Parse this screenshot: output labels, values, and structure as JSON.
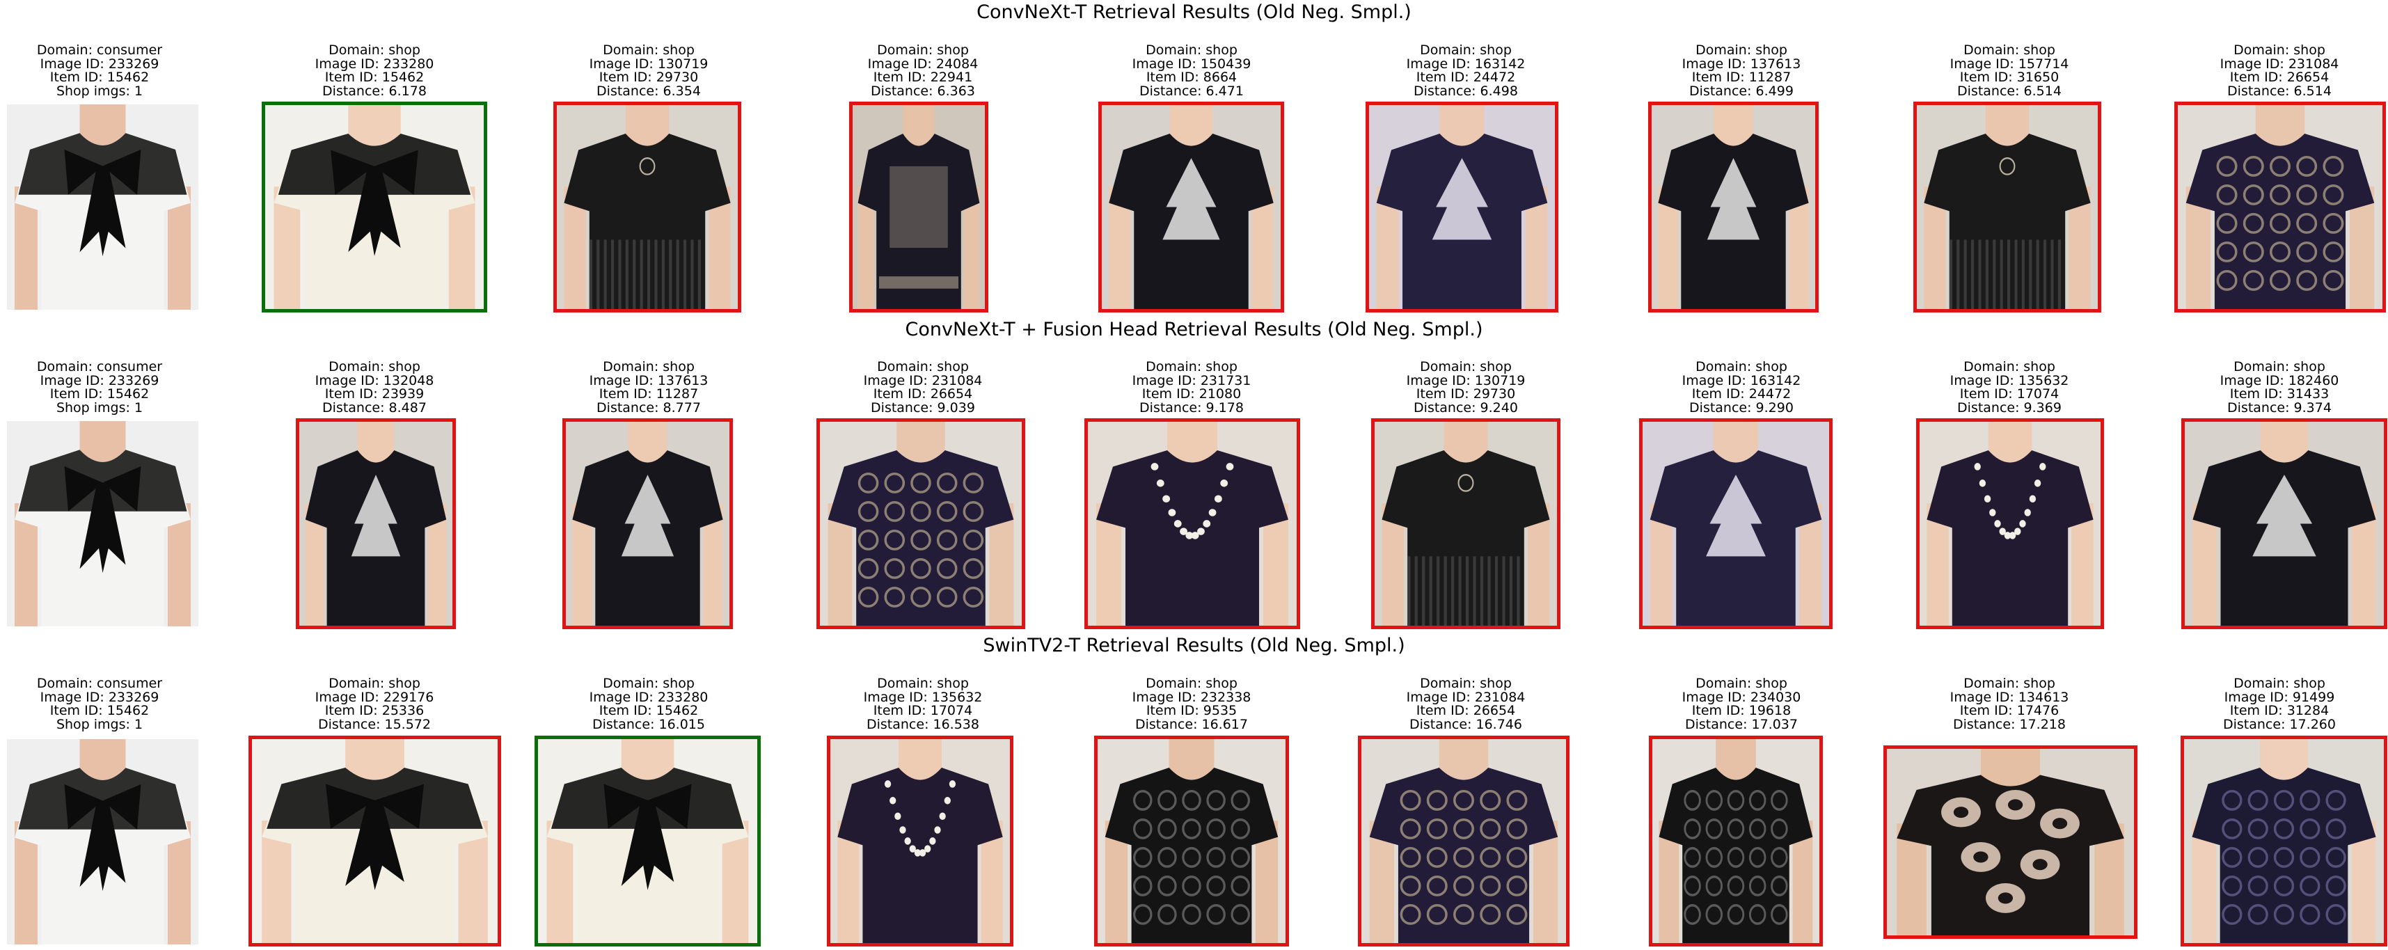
{
  "colors": {
    "match_border": "#0a6e0a",
    "nonmatch_border": "#e01414"
  },
  "rows": [
    {
      "title": "ConvNeXt-T Retrieval Results (Old Neg. Smpl.)",
      "items": [
        {
          "lines": [
            "Domain: consumer",
            "Image ID: 233269",
            "Item ID: 15462",
            "Shop imgs: 1"
          ],
          "border": "none",
          "scene": "query"
        },
        {
          "lines": [
            "Domain: shop",
            "Image ID: 233280",
            "Item ID: 15462",
            "Distance: 6.178"
          ],
          "border": "green",
          "scene": "white-top"
        },
        {
          "lines": [
            "Domain: shop",
            "Image ID: 130719",
            "Item ID: 29730",
            "Distance: 6.354"
          ],
          "border": "red",
          "scene": "black-fringe"
        },
        {
          "lines": [
            "Domain: shop",
            "Image ID: 24084",
            "Item ID: 22941",
            "Distance: 6.363"
          ],
          "border": "red",
          "scene": "dark-dress"
        },
        {
          "lines": [
            "Domain: shop",
            "Image ID: 150439",
            "Item ID: 8664",
            "Distance: 6.471"
          ],
          "border": "red",
          "scene": "black-print"
        },
        {
          "lines": [
            "Domain: shop",
            "Image ID: 163142",
            "Item ID: 24472",
            "Distance: 6.498"
          ],
          "border": "red",
          "scene": "navy-print"
        },
        {
          "lines": [
            "Domain: shop",
            "Image ID: 137613",
            "Item ID: 11287",
            "Distance: 6.499"
          ],
          "border": "red",
          "scene": "black-print"
        },
        {
          "lines": [
            "Domain: shop",
            "Image ID: 157714",
            "Item ID: 31650",
            "Distance: 6.514"
          ],
          "border": "red",
          "scene": "black-fringe"
        },
        {
          "lines": [
            "Domain: shop",
            "Image ID: 231084",
            "Item ID: 26654",
            "Distance: 6.514"
          ],
          "border": "red",
          "scene": "navy-lace"
        }
      ]
    },
    {
      "title": "ConvNeXt-T + Fusion Head Retrieval Results (Old Neg. Smpl.)",
      "items": [
        {
          "lines": [
            "Domain: consumer",
            "Image ID: 233269",
            "Item ID: 15462",
            "Shop imgs: 1"
          ],
          "border": "none",
          "scene": "query"
        },
        {
          "lines": [
            "Domain: shop",
            "Image ID: 132048",
            "Item ID: 23939",
            "Distance: 8.487"
          ],
          "border": "red",
          "scene": "black-print"
        },
        {
          "lines": [
            "Domain: shop",
            "Image ID: 137613",
            "Item ID: 11287",
            "Distance: 8.777"
          ],
          "border": "red",
          "scene": "black-print"
        },
        {
          "lines": [
            "Domain: shop",
            "Image ID: 231084",
            "Item ID: 26654",
            "Distance: 9.039"
          ],
          "border": "red",
          "scene": "navy-lace"
        },
        {
          "lines": [
            "Domain: shop",
            "Image ID: 231731",
            "Item ID: 21080",
            "Distance: 9.178"
          ],
          "border": "red",
          "scene": "navy-pearl"
        },
        {
          "lines": [
            "Domain: shop",
            "Image ID: 130719",
            "Item ID: 29730",
            "Distance: 9.240"
          ],
          "border": "red",
          "scene": "black-fringe"
        },
        {
          "lines": [
            "Domain: shop",
            "Image ID: 163142",
            "Item ID: 24472",
            "Distance: 9.290"
          ],
          "border": "red",
          "scene": "navy-print"
        },
        {
          "lines": [
            "Domain: shop",
            "Image ID: 135632",
            "Item ID: 17074",
            "Distance: 9.369"
          ],
          "border": "red",
          "scene": "navy-pearl"
        },
        {
          "lines": [
            "Domain: shop",
            "Image ID: 182460",
            "Item ID: 31433",
            "Distance: 9.374"
          ],
          "border": "red",
          "scene": "black-print"
        }
      ]
    },
    {
      "title": "SwinTV2-T Retrieval Results (Old Neg. Smpl.)",
      "items": [
        {
          "lines": [
            "Domain: consumer",
            "Image ID: 233269",
            "Item ID: 15462",
            "Shop imgs: 1"
          ],
          "border": "none",
          "scene": "query"
        },
        {
          "lines": [
            "Domain: shop",
            "Image ID: 229176",
            "Item ID: 25336",
            "Distance: 15.572"
          ],
          "border": "red",
          "scene": "white-top"
        },
        {
          "lines": [
            "Domain: shop",
            "Image ID: 233280",
            "Item ID: 15462",
            "Distance: 16.015"
          ],
          "border": "green",
          "scene": "white-top"
        },
        {
          "lines": [
            "Domain: shop",
            "Image ID: 135632",
            "Item ID: 17074",
            "Distance: 16.538"
          ],
          "border": "red",
          "scene": "navy-pearl"
        },
        {
          "lines": [
            "Domain: shop",
            "Image ID: 232338",
            "Item ID: 9535",
            "Distance: 16.617"
          ],
          "border": "red",
          "scene": "black-lace"
        },
        {
          "lines": [
            "Domain: shop",
            "Image ID: 231084",
            "Item ID: 26654",
            "Distance: 16.746"
          ],
          "border": "red",
          "scene": "navy-lace"
        },
        {
          "lines": [
            "Domain: shop",
            "Image ID: 234030",
            "Item ID: 19618",
            "Distance: 17.037"
          ],
          "border": "red",
          "scene": "black-lace"
        },
        {
          "lines": [
            "Domain: shop",
            "Image ID: 134613",
            "Item ID: 17476",
            "Distance: 17.218"
          ],
          "border": "red",
          "scene": "floral"
        },
        {
          "lines": [
            "Domain: shop",
            "Image ID: 91499",
            "Item ID: 31284",
            "Distance: 17.260"
          ],
          "border": "red",
          "scene": "navy-cami"
        }
      ]
    }
  ]
}
